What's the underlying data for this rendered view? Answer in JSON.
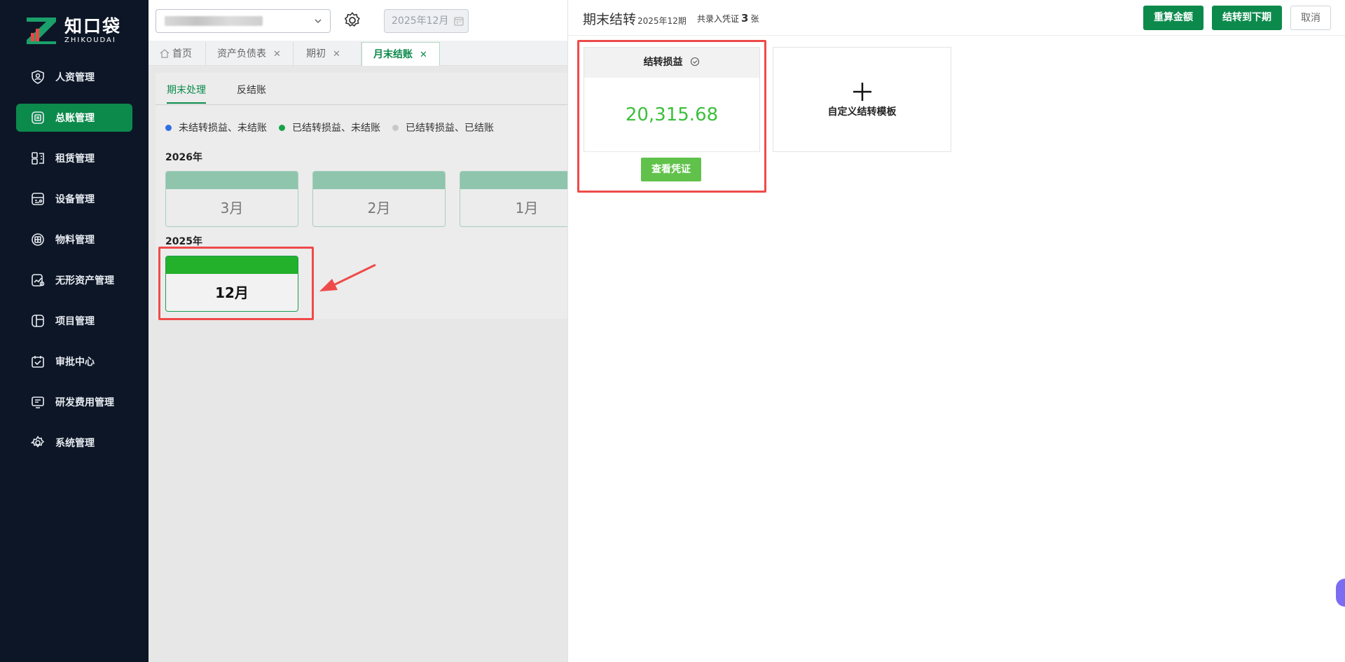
{
  "brand": {
    "name_cn": "知口袋",
    "name_en": "ZHIKOUDAI"
  },
  "sidebar": {
    "items": [
      {
        "label": "人资管理",
        "icon": "user-shield-icon",
        "active": false
      },
      {
        "label": "总账管理",
        "icon": "ledger-icon",
        "active": true
      },
      {
        "label": "租赁管理",
        "icon": "lease-icon",
        "active": false
      },
      {
        "label": "设备管理",
        "icon": "device-icon",
        "active": false
      },
      {
        "label": "物料管理",
        "icon": "box-icon",
        "active": false
      },
      {
        "label": "无形资产管理",
        "icon": "chart-icon",
        "active": false
      },
      {
        "label": "项目管理",
        "icon": "project-icon",
        "active": false
      },
      {
        "label": "审批中心",
        "icon": "calendar-check-icon",
        "active": false
      },
      {
        "label": "研发费用管理",
        "icon": "screen-icon",
        "active": false
      },
      {
        "label": "系统管理",
        "icon": "gear-icon",
        "active": false
      }
    ]
  },
  "topbar": {
    "date_value": "2025年12月"
  },
  "tabs": [
    {
      "label": "首页",
      "closable": false
    },
    {
      "label": "资产负债表",
      "closable": true
    },
    {
      "label": "期初",
      "closable": true
    },
    {
      "label": "月末结账",
      "closable": true,
      "active": true
    }
  ],
  "panel": {
    "subtabs": [
      "期末处理",
      "反结账"
    ],
    "legend": [
      {
        "label": "未结转损益、未结账",
        "color": "#2f6fe6"
      },
      {
        "label": "已结转损益、未结账",
        "color": "#16a34a"
      },
      {
        "label": "已结转损益、已结账",
        "color": "#c8c8c8"
      }
    ],
    "years": [
      {
        "year": "2026年",
        "months": [
          "3月",
          "2月",
          "1月"
        ]
      },
      {
        "year": "2025年",
        "months": [
          "12月"
        ]
      }
    ]
  },
  "drawer": {
    "title": "期末结转",
    "period": "2025年12期",
    "count_prefix": "共录入凭证",
    "count": "3",
    "count_suffix": "张",
    "buttons": {
      "recalc": "重算金额",
      "carry_forward": "结转到下期",
      "cancel": "取消"
    },
    "voucher_card": {
      "title": "结转损益",
      "amount": "20,315.68",
      "view_label": "查看凭证"
    },
    "custom_card": {
      "label": "自定义结转模板"
    }
  },
  "colors": {
    "accent": "#0c8a4c",
    "sidebar_bg": "#0c1626",
    "highlight": "#ef4a4a",
    "amount": "#3cbf3c"
  }
}
